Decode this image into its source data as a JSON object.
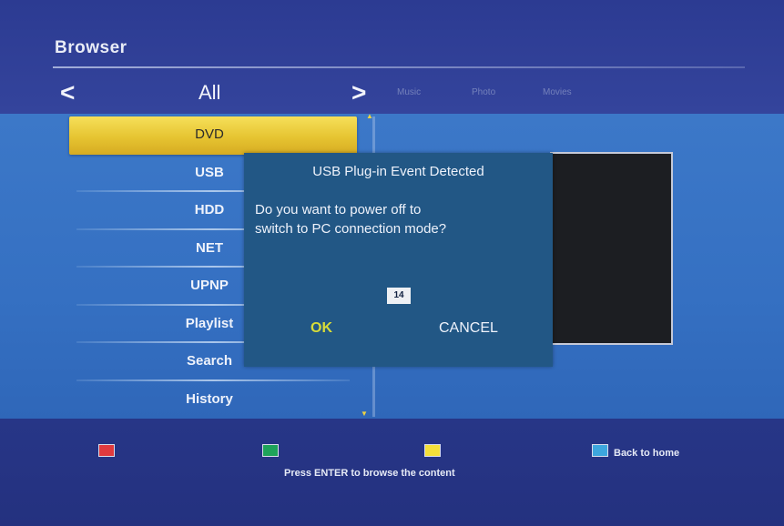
{
  "app": {
    "title": "Browser"
  },
  "category_bar": {
    "prev": "<",
    "current": "All",
    "next": ">",
    "others": [
      "Music",
      "Photo",
      "Movies"
    ]
  },
  "source_list": {
    "selected_index": 0,
    "items": [
      {
        "label": "DVD"
      },
      {
        "label": "USB"
      },
      {
        "label": "HDD"
      },
      {
        "label": "NET"
      },
      {
        "label": "UPNP"
      },
      {
        "label": "Playlist"
      },
      {
        "label": "Search"
      },
      {
        "label": "History"
      }
    ]
  },
  "dialog": {
    "title": "USB Plug-in Event Detected",
    "message_line1": "Do you want to power off to",
    "message_line2": "switch to PC connection mode?",
    "countdown": "14",
    "ok_label": "OK",
    "cancel_label": "CANCEL"
  },
  "footer": {
    "keys": [
      {
        "color": "#e03a3e",
        "name": "red-key"
      },
      {
        "color": "#1ea35a",
        "name": "green-key"
      },
      {
        "color": "#f3df3a",
        "name": "yellow-key"
      },
      {
        "color": "#3da7de",
        "name": "blue-key"
      }
    ],
    "blue_label": "Back to home",
    "hint": "Press ENTER to browse the content"
  },
  "colors": {
    "selection": "#e6c431",
    "ok_text": "#d8dc38",
    "dialog_bg": "#225785"
  }
}
